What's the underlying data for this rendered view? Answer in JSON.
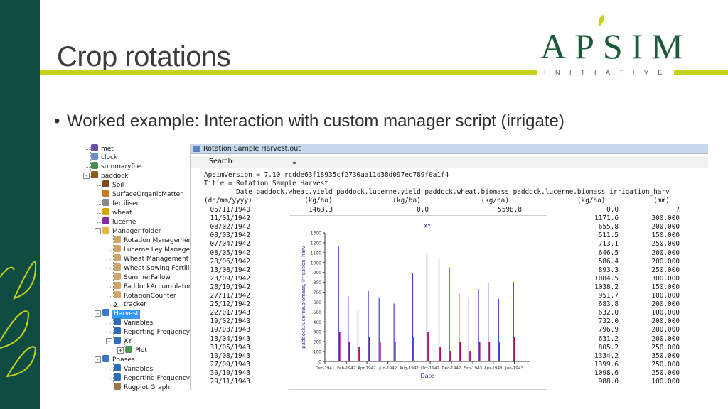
{
  "slide": {
    "title": "Crop rotations",
    "bullet": "Worked example: Interaction with custom manager script (irrigate)",
    "logo_word": "APSIM",
    "logo_sub": "INITIATIVE",
    "colors": {
      "sidebar": "#0f4d43",
      "accent_rule": "#c6d31b",
      "logo": "#1d5a3a"
    }
  },
  "tree": {
    "items": [
      {
        "label": "met",
        "icon": "weather-icon"
      },
      {
        "label": "clock",
        "icon": "clock-icon"
      },
      {
        "label": "summaryfile",
        "icon": "summary-icon"
      },
      {
        "label": "paddock",
        "icon": "paddock-icon"
      },
      {
        "label": "Soil",
        "icon": "soil-icon"
      },
      {
        "label": "SurfaceOrganicMatter",
        "icon": "surface-om-icon"
      },
      {
        "label": "fertiliser",
        "icon": "fertiliser-icon"
      },
      {
        "label": "wheat",
        "icon": "wheat-icon"
      },
      {
        "label": "lucerne",
        "icon": "lucerne-icon"
      },
      {
        "label": "Manager folder",
        "icon": "folder-icon"
      },
      {
        "label": "Rotation Management",
        "icon": "manager-icon"
      },
      {
        "label": "Lucerne Ley Managemen",
        "icon": "manager-icon"
      },
      {
        "label": "Wheat Management",
        "icon": "manager-icon"
      },
      {
        "label": "Wheat Sowing Fertiliser",
        "icon": "manager-icon"
      },
      {
        "label": "SummerFallow",
        "icon": "manager-icon"
      },
      {
        "label": "PaddockAccumulator",
        "icon": "manager-icon"
      },
      {
        "label": "RotationCounter",
        "icon": "manager-icon"
      },
      {
        "label": "tracker",
        "icon": "sigma-icon"
      },
      {
        "label": "Harvest",
        "icon": "output-file-icon"
      },
      {
        "label": "Variables",
        "icon": "variables-icon"
      },
      {
        "label": "Reporting Frequency",
        "icon": "frequency-icon"
      },
      {
        "label": "XY",
        "icon": "xy-icon"
      },
      {
        "label": "Plot",
        "icon": "plot-icon"
      },
      {
        "label": "Phases",
        "icon": "output-file-icon"
      },
      {
        "label": "Variables",
        "icon": "variables-icon"
      },
      {
        "label": "Reporting Frequency",
        "icon": "frequency-icon"
      },
      {
        "label": "Rugplot Graph",
        "icon": "rugplot-icon"
      }
    ]
  },
  "output": {
    "filename": "Rotation Sample Harvest.out",
    "search_label": "Search:",
    "version_line": "ApsimVersion = 7.10 rcdde63f18935cf2730aa11d38d097ec789f0a1f4",
    "title_line": "Title = Rotation Sample Harvest",
    "header_line": "        Date paddock.wheat.yield paddock.lucerne.yield paddock.wheat.biomass paddock.lucerne.biomass irrigation_harv",
    "units_line": "(dd/mm/yyyy)             (kg/ha)               (kg/ha)               (kg/ha)                 (kg/ha)            (mm)",
    "rows": [
      {
        "date": "05/11/1940",
        "wheat_yield": "1463.3",
        "lucerne_yield": "0.0",
        "wheat_biomass": "5598.8",
        "lucerne_biomass": "0.0",
        "irrigation": "?"
      },
      {
        "date": "11/01/1942",
        "lucerne_biomass": "1171.6",
        "irrigation": "300.000"
      },
      {
        "date": "08/02/1942",
        "lucerne_biomass": "655.8",
        "irrigation": "200.000"
      },
      {
        "date": "08/03/1942",
        "lucerne_biomass": "511.5",
        "irrigation": "150.000"
      },
      {
        "date": "07/04/1942",
        "lucerne_biomass": "713.1",
        "irrigation": "250.000"
      },
      {
        "date": "08/05/1942",
        "lucerne_biomass": "646.5",
        "irrigation": "200.000"
      },
      {
        "date": "20/06/1942",
        "lucerne_biomass": "586.4",
        "irrigation": "200.000"
      },
      {
        "date": "13/08/1942",
        "lucerne_biomass": "893.3",
        "irrigation": "250.000"
      },
      {
        "date": "23/09/1942",
        "lucerne_biomass": "1084.5",
        "irrigation": "300.000"
      },
      {
        "date": "28/10/1942",
        "lucerne_biomass": "1038.2",
        "irrigation": "150.000"
      },
      {
        "date": "27/11/1942",
        "lucerne_biomass": "951.7",
        "irrigation": "100.000"
      },
      {
        "date": "25/12/1942",
        "lucerne_biomass": "683.8",
        "irrigation": "200.000"
      },
      {
        "date": "22/01/1943",
        "lucerne_biomass": "632.0",
        "irrigation": "100.000"
      },
      {
        "date": "19/02/1943",
        "lucerne_biomass": "732.0",
        "irrigation": "200.000"
      },
      {
        "date": "19/03/1943",
        "lucerne_biomass": "796.9",
        "irrigation": "200.000"
      },
      {
        "date": "18/04/1943",
        "lucerne_biomass": "631.2",
        "irrigation": "200.000"
      },
      {
        "date": "31/05/1943",
        "lucerne_biomass": "805.2",
        "irrigation": "250.000"
      },
      {
        "date": "10/08/1943",
        "lucerne_biomass": "1334.2",
        "irrigation": "350.000"
      },
      {
        "date": "27/09/1943",
        "lucerne_biomass": "1399.6",
        "irrigation": "250.000"
      },
      {
        "date": "30/10/1943",
        "lucerne_biomass": "1098.6",
        "irrigation": "250.000"
      },
      {
        "date": "29/11/1943",
        "lucerne_biomass": "988.0",
        "irrigation": "100.000"
      }
    ]
  },
  "chart_data": {
    "type": "bar",
    "title": "XY",
    "xlabel": "Date",
    "ylabel": "paddock.lucerne.biomass, irrigation_harv",
    "ylim": [
      0,
      1300
    ],
    "yticks": [
      0,
      100,
      200,
      300,
      400,
      500,
      600,
      700,
      800,
      900,
      1000,
      1100,
      1200,
      1300
    ],
    "xlim": [
      "1941-12-01",
      "1943-07-15"
    ],
    "xticks": [
      "Dec-1941",
      "Feb-1942",
      "Apr-1942",
      "Jun-1942",
      "Aug-1942",
      "Oct-1942",
      "Dec-1942",
      "Feb-1943",
      "Apr-1943",
      "Jun-1943"
    ],
    "xtick_dates": [
      "1941-12-01",
      "1942-02-01",
      "1942-04-01",
      "1942-06-01",
      "1942-08-01",
      "1942-10-01",
      "1942-12-01",
      "1943-02-01",
      "1943-04-01",
      "1943-06-01"
    ],
    "dates": [
      "1942-01-11",
      "1942-02-08",
      "1942-03-08",
      "1942-04-07",
      "1942-05-08",
      "1942-06-20",
      "1942-08-13",
      "1942-09-23",
      "1942-10-28",
      "1942-11-27",
      "1942-12-25",
      "1943-01-22",
      "1943-02-19",
      "1943-03-19",
      "1943-04-18",
      "1943-05-31"
    ],
    "series": [
      {
        "name": "paddock.lucerne.biomass",
        "color": "#3b3bd6",
        "values": [
          1171.6,
          655.8,
          511.5,
          713.1,
          646.5,
          586.4,
          893.3,
          1084.5,
          1038.2,
          951.7,
          683.8,
          632.0,
          732.0,
          796.9,
          631.2,
          805.2
        ]
      },
      {
        "name": "irrigation_harv",
        "color": "#b0125a",
        "values": [
          300,
          200,
          150,
          250,
          200,
          200,
          250,
          300,
          150,
          100,
          200,
          100,
          200,
          200,
          200,
          250
        ]
      }
    ],
    "grid": false,
    "legend": "none"
  }
}
